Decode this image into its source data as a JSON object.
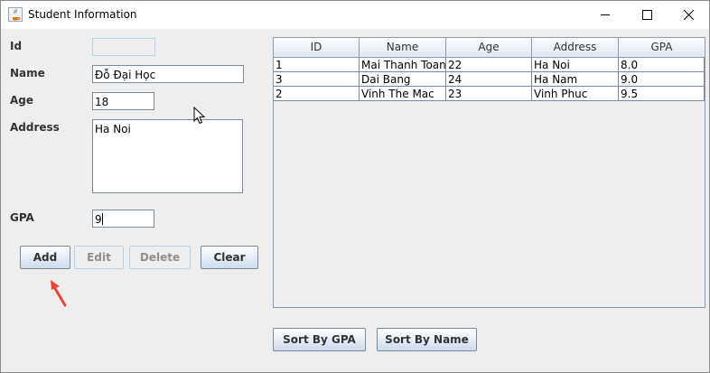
{
  "window": {
    "title": "Student Information",
    "icon": "java-icon"
  },
  "form": {
    "id_label": "Id",
    "id_value": "",
    "name_label": "Name",
    "name_value": "Đỗ Đại Học",
    "age_label": "Age",
    "age_value": "18",
    "address_label": "Address",
    "address_value": "Ha Noi",
    "gpa_label": "GPA",
    "gpa_value": "9"
  },
  "buttons": {
    "add": "Add",
    "edit": "Edit",
    "delete": "Delete",
    "clear": "Clear"
  },
  "table": {
    "columns": [
      "ID",
      "Name",
      "Age",
      "Address",
      "GPA"
    ],
    "rows": [
      [
        "1",
        "Mai Thanh Toan",
        "22",
        "Ha Noi",
        "8.0"
      ],
      [
        "3",
        "Dai Bang",
        "24",
        "Ha Nam",
        "9.0"
      ],
      [
        "2",
        "Vinh The Mac",
        "23",
        "Vinh Phuc",
        "9.5"
      ]
    ]
  },
  "sort": {
    "by_gpa": "Sort By GPA",
    "by_name": "Sort By Name"
  },
  "colors": {
    "annotation_arrow": "#e8463d",
    "button_border": "#7a8a99"
  }
}
